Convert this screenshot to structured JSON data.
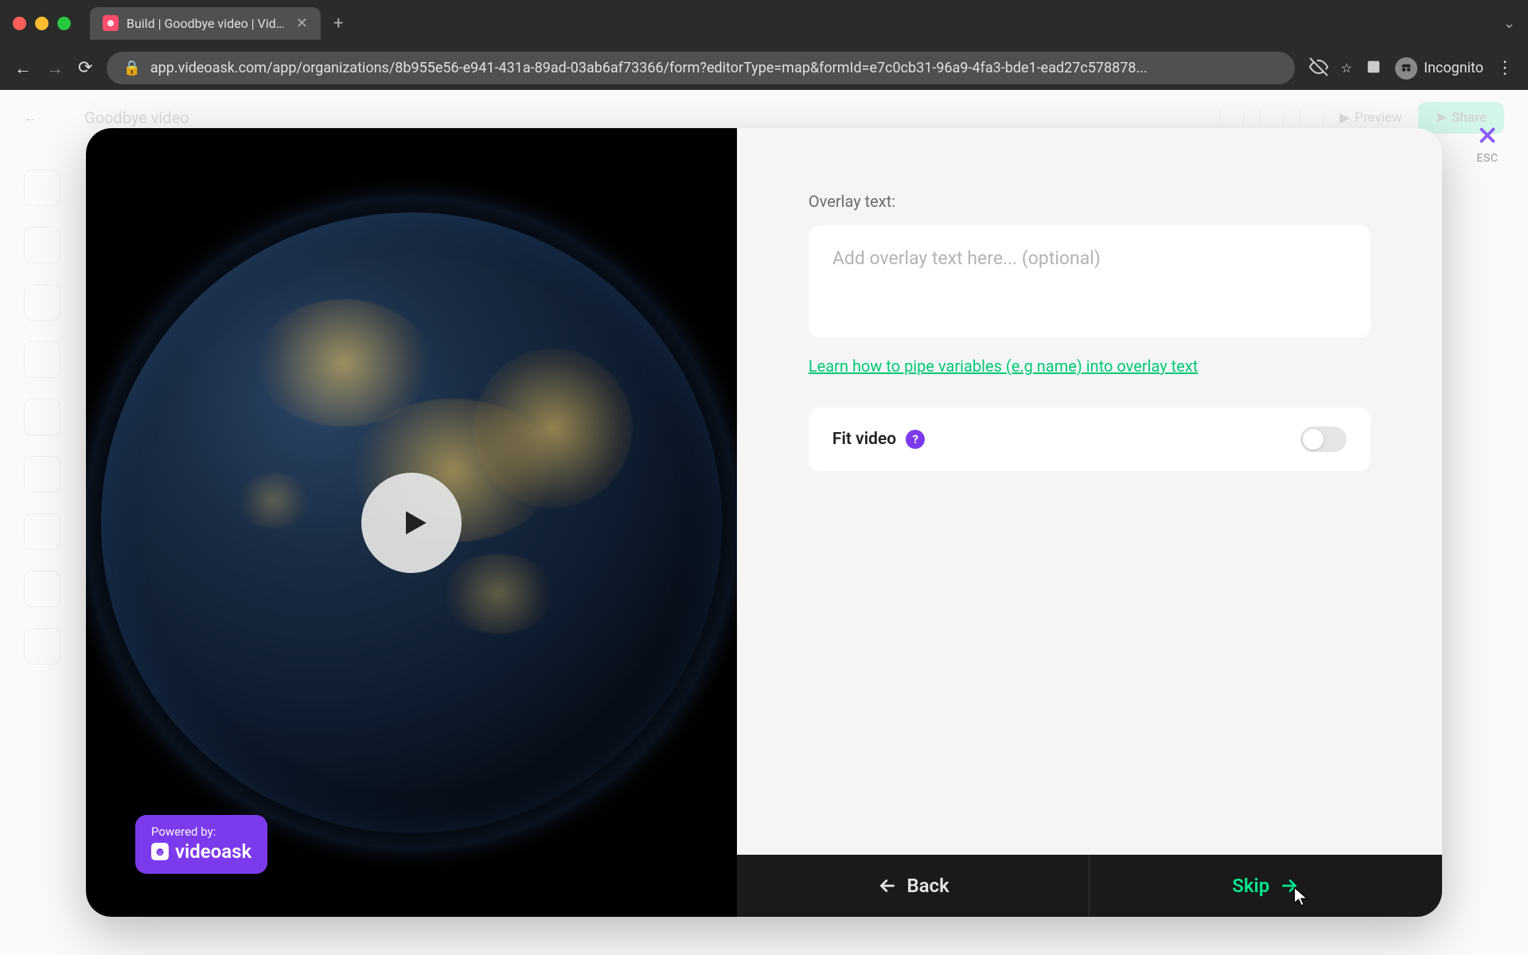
{
  "browser": {
    "tab_title": "Build | Goodbye video | VideoA",
    "url": "app.videoask.com/app/organizations/8b955e56-e941-431a-89ad-03ab6af73366/form?editorType=map&formId=e7c0cb31-96a9-4fa3-bde1-ead27c578878...",
    "incognito_label": "Incognito"
  },
  "background": {
    "page_title": "Goodbye video",
    "preview": "Preview",
    "share": "Share"
  },
  "close": {
    "esc": "ESC"
  },
  "video": {
    "powered_by": "Powered by:",
    "brand": "videoask"
  },
  "form": {
    "overlay_label": "Overlay text:",
    "overlay_placeholder": "Add overlay text here... (optional)",
    "overlay_value": "",
    "help_link": "Learn how to pipe variables (e.g name) into overlay text",
    "fit_video_label": "Fit video",
    "fit_video_on": false
  },
  "footer": {
    "back": "Back",
    "skip": "Skip"
  },
  "colors": {
    "accent_green": "#00e58f",
    "accent_purple": "#7c3aed",
    "close_purple": "#8b5cf6"
  }
}
